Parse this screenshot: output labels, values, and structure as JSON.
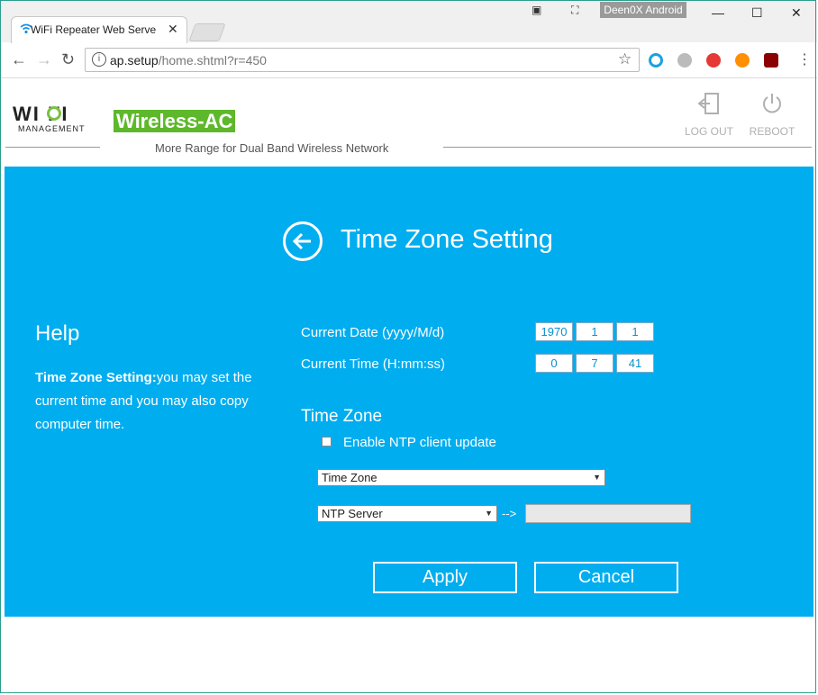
{
  "browser": {
    "tab_title": "WiFi Repeater Web Serve",
    "profile": "Deen0X Android",
    "url_host": "ap.setup",
    "url_path": "/home.shtml?r=450"
  },
  "header": {
    "logo_wifi": "WI FI",
    "logo_sub": "MANAGEMENT",
    "brand": "Wireless-AC",
    "subtitle": "More Range for Dual Band Wireless Network",
    "logout_label": "LOG OUT",
    "reboot_label": "REBOOT"
  },
  "main": {
    "title": "Time Zone Setting",
    "help": {
      "heading": "Help",
      "term": "Time Zone Setting:",
      "text": "you may set the current time and you may also copy computer time."
    },
    "date_label": "Current Date (yyyy/M/d)",
    "date": [
      "1970",
      "1",
      "1"
    ],
    "time_label": "Current Time (H:mm:ss)",
    "time": [
      "0",
      "7",
      "41"
    ],
    "tz_heading": "Time Zone",
    "ntp_checkbox_label": "Enable NTP client update",
    "timezone_select": "Time Zone",
    "ntp_select": "NTP Server",
    "arrow_text": "-->",
    "apply_label": "Apply",
    "cancel_label": "Cancel"
  },
  "colors": {
    "panel": "#00adef",
    "brand_green": "#5eb82b"
  }
}
